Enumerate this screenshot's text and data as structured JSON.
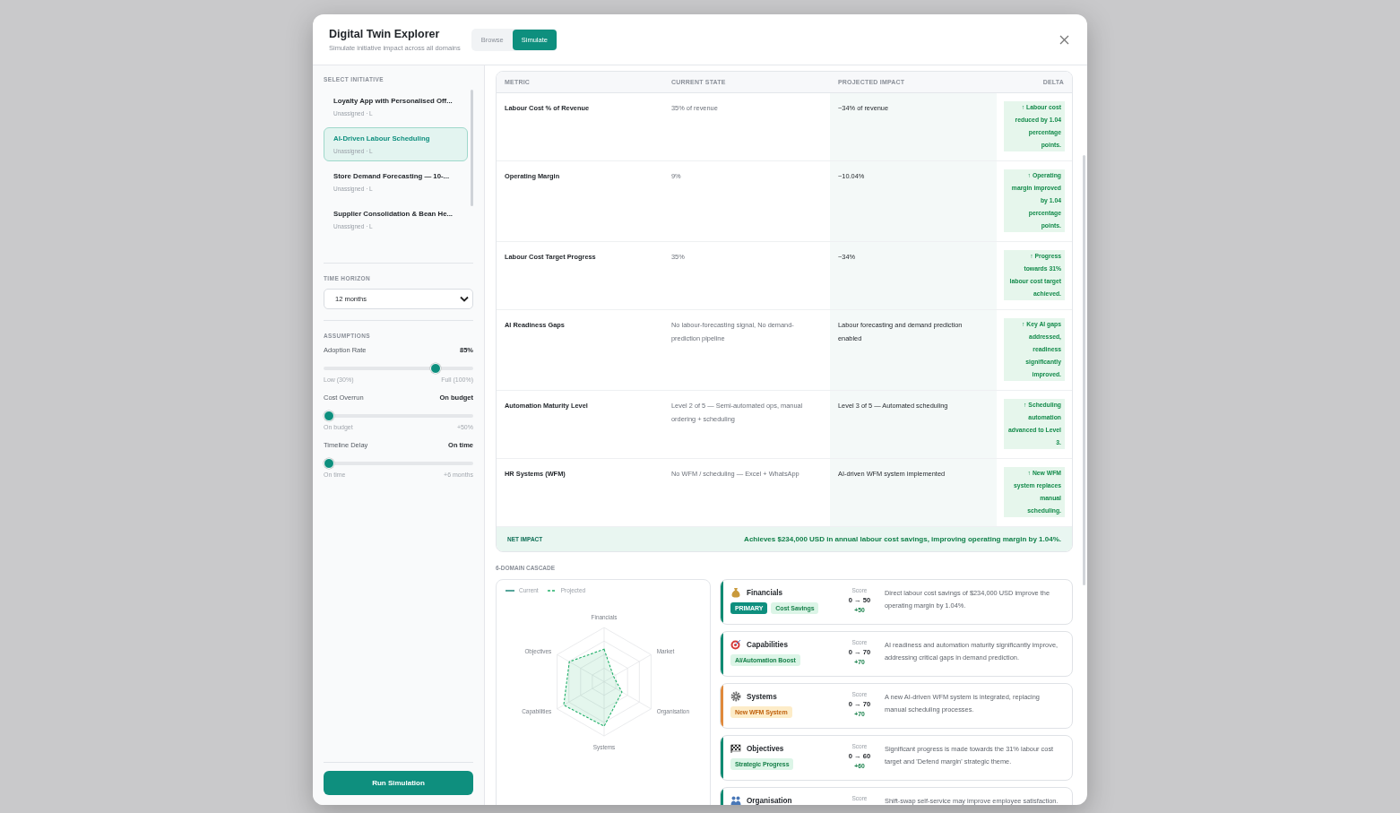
{
  "modal": {
    "title": "Digital Twin Explorer",
    "subtitle": "Simulate initiative impact across all domains",
    "tabs": [
      {
        "label": "Browse",
        "selected": false
      },
      {
        "label": "Simulate",
        "selected": true
      }
    ]
  },
  "select_initiative": {
    "heading": "SELECT INITIATIVE",
    "items": [
      {
        "title": "Loyalty App with Personalised Off...",
        "meta": "Unassigned · L",
        "selected": false
      },
      {
        "title": "AI-Driven Labour Scheduling",
        "meta": "Unassigned · L",
        "selected": true
      },
      {
        "title": "Store Demand Forecasting — 10-...",
        "meta": "Unassigned · L",
        "selected": false
      },
      {
        "title": "Supplier Consolidation & Bean He...",
        "meta": "Unassigned · L",
        "selected": false
      }
    ]
  },
  "time_horizon": {
    "heading": "TIME HORIZON",
    "value": "12 months"
  },
  "assumptions": {
    "heading": "ASSUMPTIONS",
    "sliders": [
      {
        "label": "Adoption Rate",
        "reading": "85%",
        "level": 0.77,
        "min_label": "Low (30%)",
        "max_label": "Full (100%)"
      },
      {
        "label": "Cost Overrun",
        "reading": "On budget",
        "level": 0,
        "min_label": "On budget",
        "max_label": "+50%"
      },
      {
        "label": "Timeline Delay",
        "reading": "On time",
        "level": 0,
        "min_label": "On time",
        "max_label": "+6 months"
      }
    ]
  },
  "run_button": "Run Simulation",
  "impact_table": {
    "columns": [
      "METRIC",
      "CURRENT STATE",
      "PROJECTED IMPACT",
      "DELTA"
    ],
    "rows": [
      {
        "metric": "Labour Cost % of Revenue",
        "current": "35% of revenue",
        "projected": "~34% of revenue",
        "delta": "↑ Labour cost reduced by 1.04 percentage points."
      },
      {
        "metric": "Operating Margin",
        "current": "9%",
        "projected": "~10.04%",
        "delta": "↑ Operating margin improved by 1.04 percentage points."
      },
      {
        "metric": "Labour Cost Target Progress",
        "current": "35%",
        "projected": "~34%",
        "delta": "↑ Progress towards 31% labour cost target achieved."
      },
      {
        "metric": "AI Readiness Gaps",
        "current": "No labour-forecasting signal, No demand-prediction pipeline",
        "projected": "Labour forecasting and demand prediction enabled",
        "delta": "↑ Key AI gaps addressed, readiness significantly improved."
      },
      {
        "metric": "Automation Maturity Level",
        "current": "Level 2 of 5 — Semi-automated ops, manual ordering + scheduling",
        "projected": "Level 3 of 5 — Automated scheduling",
        "delta": "↑ Scheduling automation advanced to Level 3."
      },
      {
        "metric": "HR Systems (WFM)",
        "current": "No WFM / scheduling — Excel + WhatsApp",
        "projected": "AI-driven WFM system implemented",
        "delta": "↑ New WFM system replaces manual scheduling."
      }
    ],
    "net_impact": {
      "label": "NET IMPACT",
      "text": "Achieves $234,000 USD in annual labour cost savings, improving operating margin by 1.04%."
    }
  },
  "cascade": {
    "heading": "6-DOMAIN CASCADE",
    "legend": [
      {
        "label": "Current",
        "kind": "solid"
      },
      {
        "label": "Projected",
        "kind": "dashed"
      }
    ],
    "axes": [
      "Financials",
      "Market",
      "Organisation",
      "Systems",
      "Capabilities",
      "Objectives"
    ],
    "domains": [
      {
        "name": "Financials",
        "color": "#0f8a72",
        "tags": [
          {
            "label": "PRIMARY",
            "kind": "primary"
          },
          {
            "label": "Cost Savings",
            "kind": "positive"
          }
        ],
        "score_label": "Score",
        "score": "0 → 50",
        "change": "+50",
        "description": "Direct labour cost savings of $234,000 USD improve the operating margin by 1.04%."
      },
      {
        "name": "Capabilities",
        "color": "#0f8a72",
        "tags": [
          {
            "label": "AI/Automation Boost",
            "kind": "positive"
          }
        ],
        "score_label": "Score",
        "score": "0 → 70",
        "change": "+70",
        "description": "AI readiness and automation maturity significantly improve, addressing critical gaps in demand prediction."
      },
      {
        "name": "Systems",
        "color": "#e0893b",
        "tags": [
          {
            "label": "New WFM System",
            "kind": "warning"
          }
        ],
        "score_label": "Score",
        "score": "0 → 70",
        "change": "+70",
        "description": "A new AI-driven WFM system is integrated, replacing manual scheduling processes."
      },
      {
        "name": "Objectives",
        "color": "#0f8a72",
        "tags": [
          {
            "label": "Strategic Progress",
            "kind": "positive"
          }
        ],
        "score_label": "Score",
        "score": "0 → 60",
        "change": "+60",
        "description": "Significant progress is made towards the 31% labour cost target and 'Defend margin' strategic theme."
      },
      {
        "name": "Organisation",
        "color": "#0f8a72",
        "score_label": "Score",
        "description": "Shift-swap self-service may improve employee satisfaction."
      }
    ]
  }
}
